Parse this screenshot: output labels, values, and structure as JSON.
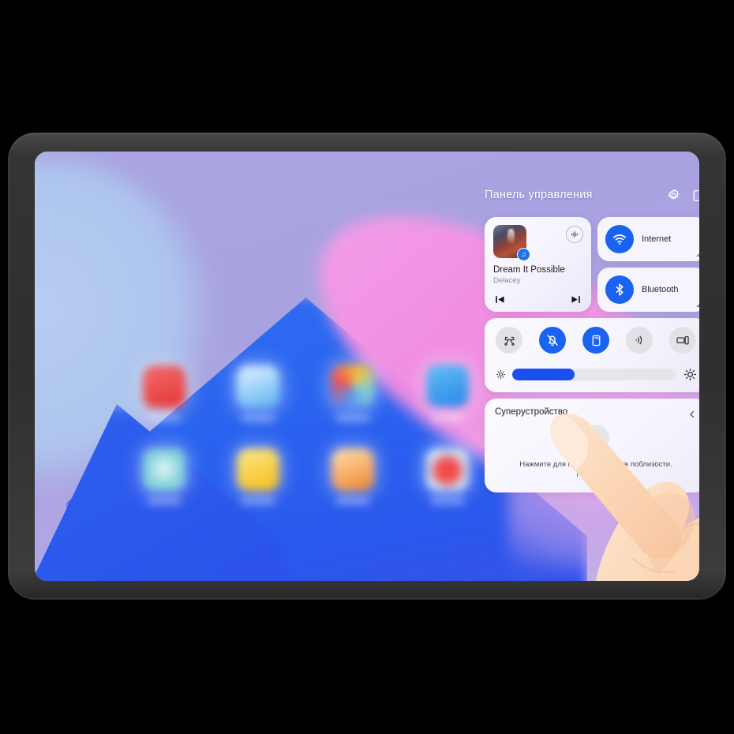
{
  "device": {
    "kind": "tablet",
    "frame_color": "#333333",
    "orientation": "landscape"
  },
  "wallpaper": {
    "description": "abstract gradient wallpaper with purple sky, blue mountain, pink ellipse",
    "colors": {
      "sky": "#a9a3e0",
      "mountain": "#2a63ef",
      "pink": "#f58de3",
      "blue_circle": "#b0c7ee"
    }
  },
  "home_screen": {
    "icon_rows": [
      [
        {
          "name": "app-icon-red",
          "color": "#ea4335"
        },
        {
          "name": "app-icon-lightblue",
          "color": "#5ab4f5"
        },
        {
          "name": "app-icon-multicolor",
          "color": "#f2b33d"
        },
        {
          "name": "app-icon-blue-cloud",
          "color": "#3aa0f0"
        }
      ],
      [
        {
          "name": "app-icon-teal",
          "color": "#7fd0d6"
        },
        {
          "name": "app-icon-yellow",
          "color": "#f6c427"
        },
        {
          "name": "app-icon-orange",
          "color": "#f08c26"
        },
        {
          "name": "app-icon-maps-pin",
          "color": "#ef4a4a"
        }
      ]
    ],
    "dock_icons": [
      {
        "name": "dock-icon-orange-player",
        "color": "#f08f2a"
      },
      {
        "name": "dock-icon-violet",
        "color": "#7f8ae8"
      },
      {
        "name": "dock-icon-red-camera",
        "color": "#f24b4b"
      },
      {
        "name": "dock-icon-blue",
        "color": "#29a6f2"
      },
      {
        "name": "dock-icon-dark",
        "color": "#4d4d52"
      },
      {
        "name": "dock-icon-gallery",
        "color": "#e8a0c8"
      },
      {
        "name": "dock-icon-gray",
        "color": "#8a8a90"
      },
      {
        "name": "dock-icon-amber",
        "color": "#f0a431"
      },
      {
        "name": "dock-icon-red",
        "color": "#ef3f44"
      }
    ]
  },
  "control_panel": {
    "title": "Панель управления",
    "header_icons": [
      {
        "name": "settings-gear-icon",
        "label": "Настройки"
      },
      {
        "name": "edit-icon",
        "label": "Изменить"
      }
    ],
    "media": {
      "title": "Dream It Possible",
      "artist": "Delacey",
      "cast_icon": "cast-audio-icon",
      "album_badge_icon": "music-note-icon",
      "prev_label": "Предыдущий",
      "next_label": "Следующий"
    },
    "connectivity": [
      {
        "name": "internet",
        "label": "Internet",
        "icon": "wifi-icon",
        "active": true,
        "accent": "#1a62f0"
      },
      {
        "name": "bluetooth",
        "label": "Bluetooth",
        "icon": "bluetooth-icon",
        "active": true,
        "accent": "#1a62f0"
      }
    ],
    "toggles": [
      {
        "name": "screenshot",
        "icon": "screenshot-scissors-icon",
        "active": false
      },
      {
        "name": "silent-mode",
        "icon": "bell-muted-icon",
        "active": true
      },
      {
        "name": "auto-rotate",
        "icon": "rotate-icon",
        "active": true
      },
      {
        "name": "nfc",
        "icon": "nfc-waves-icon",
        "active": false
      },
      {
        "name": "multi-screen",
        "icon": "multi-screen-icon",
        "active": false
      }
    ],
    "brightness": {
      "value": 38,
      "min_icon": "sun-small-icon",
      "max_icon": "sun-large-icon",
      "fill_color": "#1a4ff0"
    },
    "super_device": {
      "title": "Суперустройство",
      "collapse_icon": "chevron-left-icon",
      "search_icon": "search-icon",
      "hint": "Нажмите для поиска устройств поблизости.",
      "link": "Подробнее",
      "link_color": "#1a62f0"
    }
  },
  "overlay": {
    "hand": {
      "name": "pointing-hand-illustration",
      "skin": "#fbd9bd"
    }
  }
}
